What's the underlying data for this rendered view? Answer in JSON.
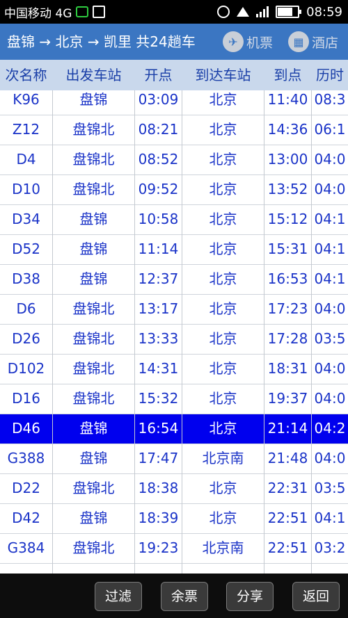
{
  "status": {
    "carrier": "中国移动 4G",
    "time": "08:59",
    "icons": [
      "wechat-icon",
      "lock-icon",
      "alarm-icon",
      "wifi-icon",
      "signal-icon",
      "battery-icon"
    ],
    "battery_level": 0.8
  },
  "appbar": {
    "route": "盘锦 → 北京 → 凯里 共24趟车",
    "flight_label": "机票",
    "hotel_label": "酒店",
    "bg_color": "#3b76c2"
  },
  "table": {
    "headers": [
      "次名称",
      "出发车站",
      "开点",
      "到达车站",
      "到点",
      "历时"
    ],
    "partial_row": [
      "",
      "",
      "",
      "",
      "",
      ""
    ],
    "rows": [
      [
        "K96",
        "盘锦",
        "03:09",
        "北京",
        "11:40",
        "08:3"
      ],
      [
        "Z12",
        "盘锦北",
        "08:21",
        "北京",
        "14:36",
        "06:1"
      ],
      [
        "D4",
        "盘锦北",
        "08:52",
        "北京",
        "13:00",
        "04:0"
      ],
      [
        "D10",
        "盘锦北",
        "09:52",
        "北京",
        "13:52",
        "04:0"
      ],
      [
        "D34",
        "盘锦",
        "10:58",
        "北京",
        "15:12",
        "04:1"
      ],
      [
        "D52",
        "盘锦",
        "11:14",
        "北京",
        "15:31",
        "04:1"
      ],
      [
        "D38",
        "盘锦",
        "12:37",
        "北京",
        "16:53",
        "04:1"
      ],
      [
        "D6",
        "盘锦北",
        "13:17",
        "北京",
        "17:23",
        "04:0"
      ],
      [
        "D26",
        "盘锦北",
        "13:33",
        "北京",
        "17:28",
        "03:5"
      ],
      [
        "D102",
        "盘锦北",
        "14:31",
        "北京",
        "18:31",
        "04:0"
      ],
      [
        "D16",
        "盘锦北",
        "15:32",
        "北京",
        "19:37",
        "04:0"
      ],
      [
        "D46",
        "盘锦",
        "16:54",
        "北京",
        "21:14",
        "04:2"
      ],
      [
        "G388",
        "盘锦",
        "17:47",
        "北京南",
        "21:48",
        "04:0"
      ],
      [
        "D22",
        "盘锦北",
        "18:38",
        "北京",
        "22:31",
        "03:5"
      ],
      [
        "D42",
        "盘锦",
        "18:39",
        "北京",
        "22:51",
        "04:1"
      ],
      [
        "G384",
        "盘锦北",
        "19:23",
        "北京南",
        "22:51",
        "03:2"
      ]
    ],
    "selected_index": 11,
    "selected_color": "#0000ee",
    "text_color": "#1a33c8"
  },
  "bottom": {
    "filter_label": "过滤",
    "tickets_label": "余票",
    "share_label": "分享",
    "back_label": "返回"
  }
}
